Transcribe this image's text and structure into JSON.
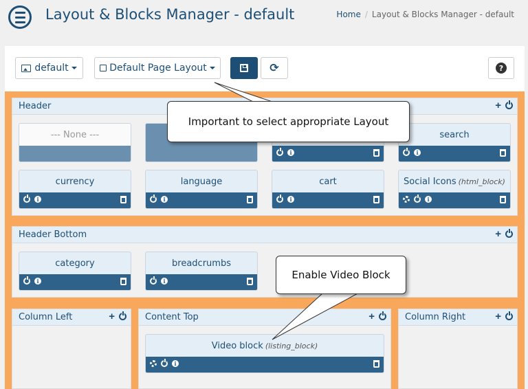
{
  "header": {
    "title": "Layout & Blocks Manager - default",
    "breadcrumb_home": "Home",
    "breadcrumb_current": "Layout & Blocks Manager - default"
  },
  "toolbar": {
    "template_label": "default",
    "layout_label": "Default Page Layout"
  },
  "sections": {
    "header": {
      "title": "Header",
      "blocks": [
        {
          "name": "--- None ---"
        },
        {
          "name": ""
        },
        {
          "name": ""
        },
        {
          "name": "search"
        },
        {
          "name": "currency"
        },
        {
          "name": "language"
        },
        {
          "name": "cart"
        },
        {
          "name": "Social Icons",
          "sub": "(html_block)"
        }
      ]
    },
    "header_bottom": {
      "title": "Header Bottom",
      "blocks": [
        {
          "name": "category"
        },
        {
          "name": "breadcrumbs"
        }
      ]
    },
    "column_left": {
      "title": "Column Left"
    },
    "content_top": {
      "title": "Content Top",
      "blocks": [
        {
          "name": "Video block",
          "sub": "(listing_block)"
        }
      ]
    },
    "column_right": {
      "title": "Column Right"
    }
  },
  "callouts": {
    "layout": "Important to select appropriate Layout",
    "video": "Enable Video Block"
  },
  "colors": {
    "primary": "#1d4f76",
    "block_bar": "#2f628a",
    "highlight_bg": "#f9a75b",
    "section_header": "#e4eef6"
  }
}
